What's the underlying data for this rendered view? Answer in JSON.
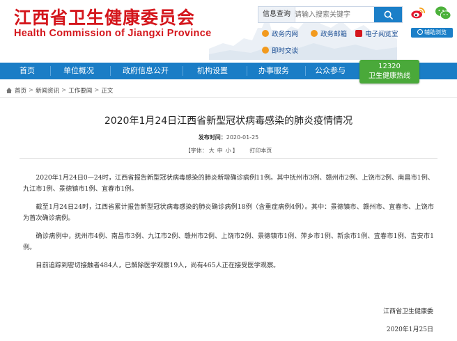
{
  "header": {
    "logo_cn": "江西省卫生健康委员会",
    "logo_en": "Health Commission of Jiangxi Province",
    "search": {
      "label": "信息查询",
      "placeholder": "请输入搜索关键字"
    },
    "links": {
      "mailbox_gov": "政务内网",
      "mailbox_public": "政务邮箱",
      "e_office": "电子阅览室",
      "barrier_free": "辅助浏览",
      "interview": "即时交谈"
    },
    "icons": {
      "weibo": "weibo-icon",
      "wechat": "wechat-icon",
      "search": "search-icon"
    },
    "brand_color": "#d4161c"
  },
  "nav": {
    "items": [
      {
        "label": "首页"
      },
      {
        "label": "单位概况"
      },
      {
        "label": "政府信息公开"
      },
      {
        "label": "机构设置"
      },
      {
        "label": "办事服务"
      },
      {
        "label": "公众参与"
      }
    ],
    "hotline": {
      "number": "12320",
      "label": "卫生健康热线"
    },
    "color": "#1a7dc6"
  },
  "breadcrumb": {
    "items": [
      "首页",
      "新闻资讯",
      "工作要闻",
      "正文"
    ],
    "separator": ">"
  },
  "article": {
    "title": "2020年1月24日江西省新型冠状病毒感染的肺炎疫情情况",
    "date_label": "发布时间：",
    "date": "2020-01-25",
    "font_label": "【字体：",
    "font_large": "大",
    "font_medium": "中",
    "font_small": "小",
    "font_close": "】",
    "print_label": "打印本页",
    "paragraphs": [
      "2020年1月24日0—24时，江西省报告新型冠状病毒感染的肺炎新增确诊病例11例。其中抚州市3例、赣州市2例、上饶市2例、南昌市1例、九江市1例、景德镇市1例、宜春市1例。",
      "截至1月24日24时，江西省累计报告新型冠状病毒感染的肺炎确诊病例18例（含重症病例4例）。其中：景德镇市、赣州市、宜春市、上饶市为首次确诊病例。",
      "确诊病例中，抚州市4例、南昌市3例、九江市2例、赣州市2例、上饶市2例、景德镇市1例、萍乡市1例、新余市1例、宜春市1例、吉安市1例。",
      "目前追踪到密切接触者484人，已解除医学观察19人，尚有465人正在接受医学观察。"
    ],
    "signature": "江西省卫生健康委",
    "sign_date": "2020年1月25日"
  }
}
